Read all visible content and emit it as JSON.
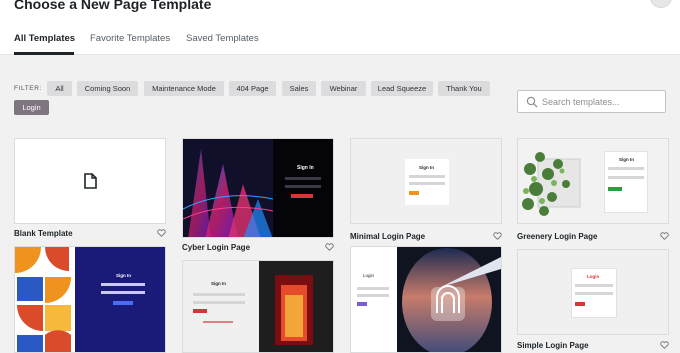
{
  "header": {
    "title": "Choose a New Page Template",
    "tabs": [
      {
        "label": "All Templates",
        "active": true
      },
      {
        "label": "Favorite Templates",
        "active": false
      },
      {
        "label": "Saved Templates",
        "active": false
      }
    ]
  },
  "filter": {
    "label": "FILTER:",
    "chips": [
      {
        "label": "All",
        "selected": false
      },
      {
        "label": "Coming Soon",
        "selected": false
      },
      {
        "label": "Maintenance Mode",
        "selected": false
      },
      {
        "label": "404 Page",
        "selected": false
      },
      {
        "label": "Sales",
        "selected": false
      },
      {
        "label": "Webinar",
        "selected": false
      },
      {
        "label": "Lead Squeeze",
        "selected": false
      },
      {
        "label": "Thank You",
        "selected": false
      },
      {
        "label": "Login",
        "selected": true
      }
    ]
  },
  "search": {
    "placeholder": "Search templates..."
  },
  "templates": [
    {
      "title": "Blank Template"
    },
    {
      "title": "Cyber Login Page"
    },
    {
      "title": "Minimal Login Page"
    },
    {
      "title": "Greenery Login Page"
    },
    {
      "title": ""
    },
    {
      "title": ""
    },
    {
      "title": ""
    },
    {
      "title": "Simple Login Page"
    }
  ],
  "previews": {
    "cyber_heading": "Sign In",
    "greenery_heading": "Sign In",
    "minimal_heading": "Sign In",
    "row2_heading_1": "Sign In",
    "row2_heading_2": "Sign In",
    "row2_heading_3": "Login",
    "simple_heading": "Login"
  },
  "colors": {
    "chip_selected": "#7f7581",
    "chip": "#dcdcde",
    "accent_orange": "#f0931e",
    "accent_red": "#d63638"
  }
}
